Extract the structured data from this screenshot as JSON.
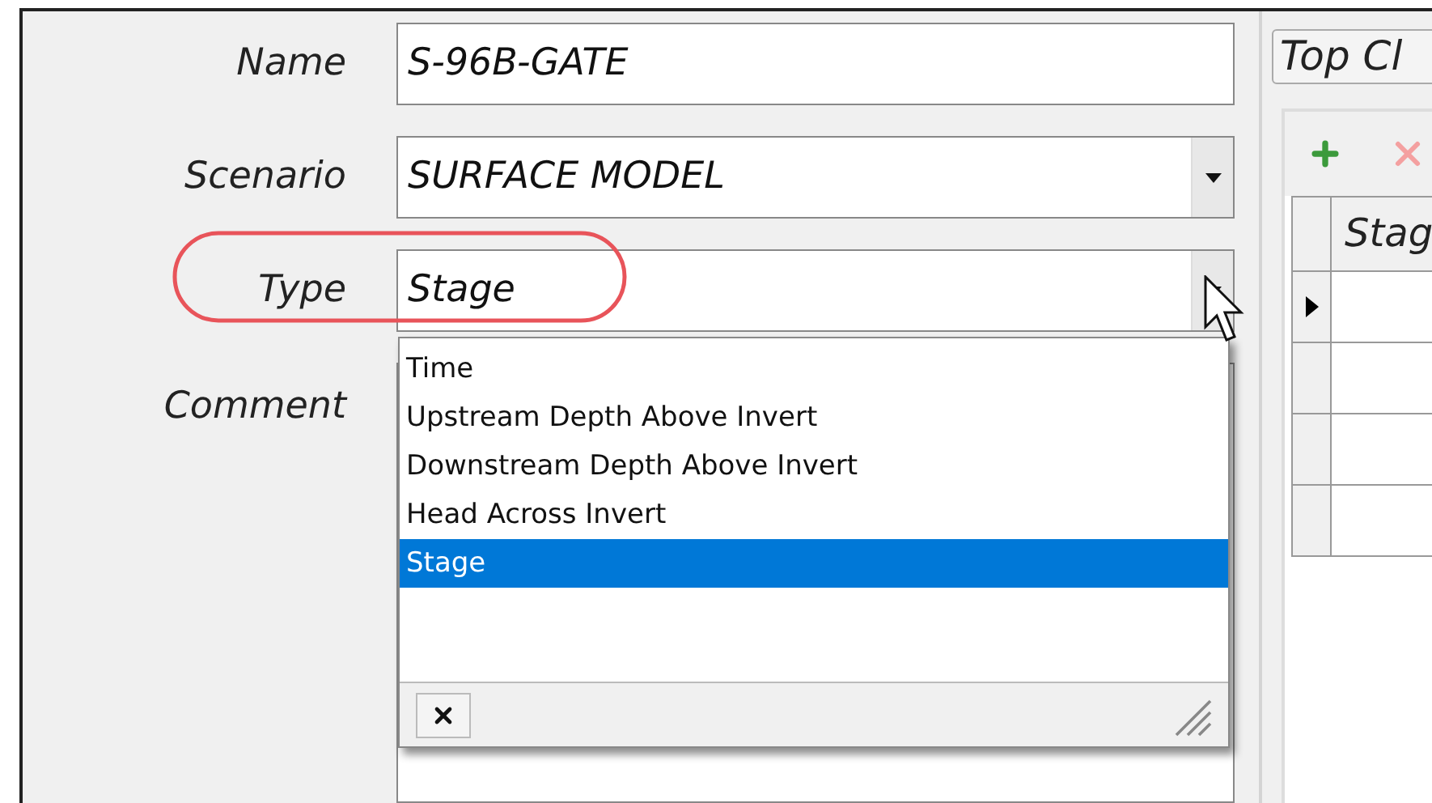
{
  "form": {
    "fields": [
      {
        "label": "Name",
        "kind": "text",
        "value": "S-96B-GATE"
      },
      {
        "label": "Scenario",
        "kind": "dropdown",
        "value": "SURFACE MODEL"
      },
      {
        "label": "Type",
        "kind": "dropdown",
        "value": "Stage",
        "highlighted": true
      },
      {
        "label": "Comment",
        "kind": "textarea"
      }
    ]
  },
  "type_dropdown": {
    "options": [
      {
        "label": "Time",
        "selected": false
      },
      {
        "label": "Upstream Depth Above Invert",
        "selected": false
      },
      {
        "label": "Downstream Depth Above Invert",
        "selected": false
      },
      {
        "label": "Head Across Invert",
        "selected": false
      },
      {
        "label": "Stage",
        "selected": true
      }
    ]
  },
  "right_panel": {
    "tab": "Top Cl",
    "table": {
      "columns": [
        "Stag"
      ],
      "rows": [
        {
          "selected": true
        },
        {
          "selected": false
        },
        {
          "selected": false
        },
        {
          "selected": false
        }
      ]
    }
  }
}
